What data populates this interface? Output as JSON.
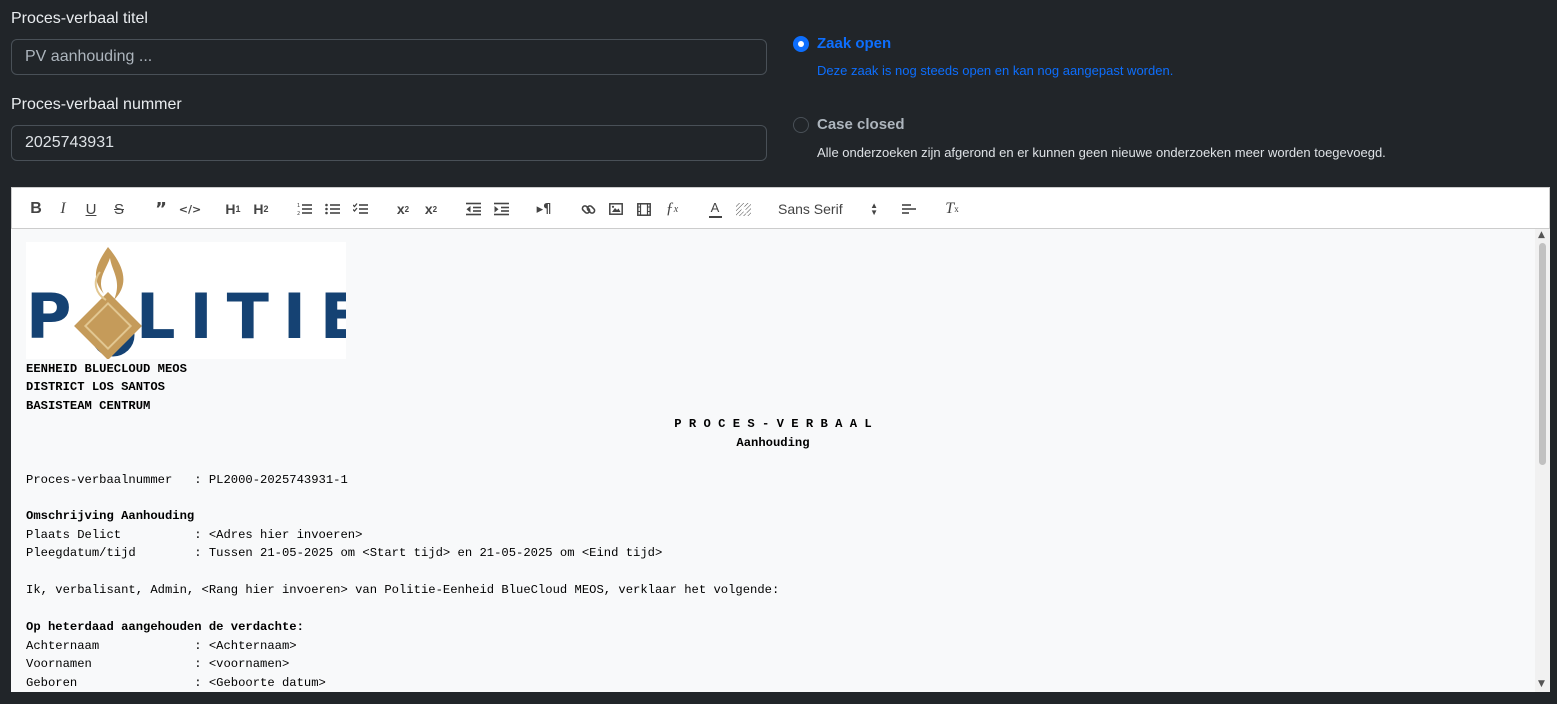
{
  "form": {
    "title_label": "Proces-verbaal titel",
    "title_placeholder": "PV aanhouding ...",
    "title_value": "",
    "number_label": "Proces-verbaal nummer",
    "number_value": "2025743931"
  },
  "status": {
    "open_label": "Zaak open",
    "open_help": "Deze zaak is nog steeds open en kan nog aangepast worden.",
    "closed_label": "Case closed",
    "closed_help": "Alle onderzoeken zijn afgerond en er kunnen geen nieuwe onderzoeken meer worden toegevoegd.",
    "selected": "open",
    "colors": {
      "accent": "#0d6efd",
      "help_closed": "#dee2e6"
    }
  },
  "toolbar": {
    "font_value": "Sans Serif",
    "icons": [
      "bold-icon",
      "italic-icon",
      "underline-icon",
      "strike-icon",
      "blockquote-icon",
      "code-block-icon",
      "header-1-icon",
      "header-2-icon",
      "ordered-list-icon",
      "bullet-list-icon",
      "check-list-icon",
      "subscript-icon",
      "superscript-icon",
      "outdent-icon",
      "indent-icon",
      "direction-rtl-icon",
      "link-icon",
      "image-icon",
      "video-icon",
      "formula-icon",
      "text-color-icon",
      "background-color-icon",
      "align-icon",
      "clean-format-icon"
    ]
  },
  "logo": {
    "text_left": "P",
    "text_right": "LITIE",
    "colors": {
      "blue": "#154273",
      "gold": "#c59b5a"
    }
  },
  "document": {
    "unit": "EENHEID BLUECLOUD MEOS",
    "district": "DISTRICT LOS SANTOS",
    "team": "BASISTEAM CENTRUM",
    "heading": "P R O C E S - V E R B A A L",
    "subheading": "Aanhouding",
    "pv_number_line": "Proces-verbaalnummer   : PL2000-2025743931-1",
    "section1_title": "Omschrijving Aanhouding",
    "place_line": "Plaats Delict          : <Adres hier invoeren>",
    "date_line": "Pleegdatum/tijd        : Tussen 21-05-2025 om <Start tijd> en 21-05-2025 om <Eind tijd>",
    "statement_line": "Ik, verbalisant, Admin, <Rang hier invoeren> van Politie-Eenheid BlueCloud MEOS, verklaar het volgende:",
    "section2_title": "Op heterdaad aangehouden de verdachte:",
    "surname_line": "Achternaam             : <Achternaam>",
    "firstnames_line": "Voornamen              : <voornamen>",
    "born_line": "Geboren                : <Geboorte datum>"
  }
}
